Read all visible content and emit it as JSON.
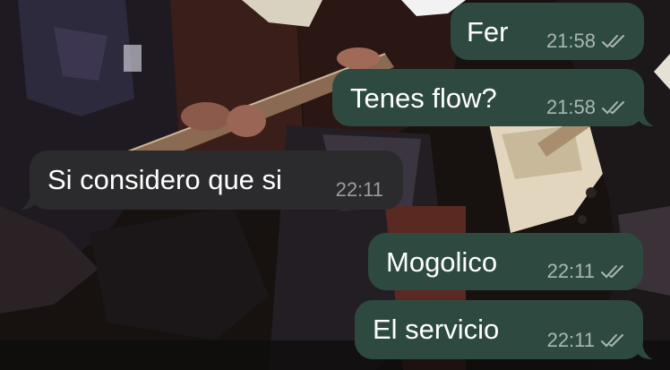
{
  "chat": {
    "messages": [
      {
        "direction": "outgoing",
        "text": "Fer",
        "time": "21:58",
        "status_icon": "double-check-icon"
      },
      {
        "direction": "outgoing",
        "text": "Tenes flow?",
        "time": "21:58",
        "status_icon": "double-check-icon"
      },
      {
        "direction": "incoming",
        "text": "Si considero que si",
        "time": "22:11"
      },
      {
        "direction": "outgoing",
        "text": "Mogolico",
        "time": "22:11",
        "status_icon": "double-check-icon"
      },
      {
        "direction": "outgoing",
        "text": "El servicio",
        "time": "22:11",
        "status_icon": "double-check-icon"
      }
    ]
  },
  "colors": {
    "outgoing_bubble": "#2e4a40",
    "incoming_bubble": "#2b2a2d",
    "timestamp_text": "#a8b7b1",
    "wallpaper_base": "#140f12"
  },
  "wallpaper": {
    "description_icon": "rock-band-artwork-wallpaper"
  }
}
